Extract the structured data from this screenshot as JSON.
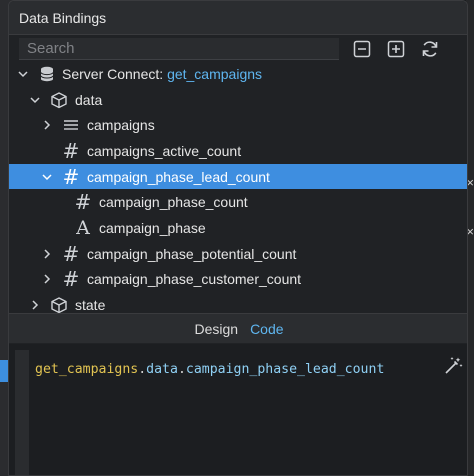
{
  "panel": {
    "title": "Data Bindings"
  },
  "search": {
    "placeholder": "Search"
  },
  "toolbar": {
    "collapse_icon": "collapse-all-icon",
    "expand_icon": "expand-all-icon",
    "refresh_icon": "refresh-icon"
  },
  "tree": {
    "server_connect": {
      "prefix": "Server Connect: ",
      "name": "get_campaigns",
      "icon": "database-icon"
    },
    "data": {
      "label": "data",
      "icon": "cube-icon"
    },
    "campaigns": {
      "label": "campaigns",
      "icon": "list-icon"
    },
    "campaigns_active_count": {
      "label": "campaigns_active_count",
      "icon": "hash-icon"
    },
    "campaign_phase_lead_count": {
      "label": "campaign_phase_lead_count",
      "icon": "hash-icon",
      "selected": true
    },
    "campaign_phase_count": {
      "label": "campaign_phase_count",
      "icon": "hash-icon"
    },
    "campaign_phase": {
      "label": "campaign_phase",
      "icon": "text-icon"
    },
    "campaign_phase_potential_count": {
      "label": "campaign_phase_potential_count",
      "icon": "hash-icon"
    },
    "campaign_phase_customer_count": {
      "label": "campaign_phase_customer_count",
      "icon": "hash-icon"
    },
    "state": {
      "label": "state",
      "icon": "cube-icon"
    }
  },
  "tabs": {
    "design": "Design",
    "code": "Code",
    "active": "Code"
  },
  "code": {
    "part1": "get_campaigns",
    "dot1": ".",
    "part2": "data",
    "dot2": ".",
    "part3": "campaign_phase_lead_count",
    "wand_icon": "magic-wand-icon"
  },
  "colors": {
    "selection": "#3e8ee0",
    "accent": "#5fb6f0",
    "code_identifier": "#e2c452"
  }
}
